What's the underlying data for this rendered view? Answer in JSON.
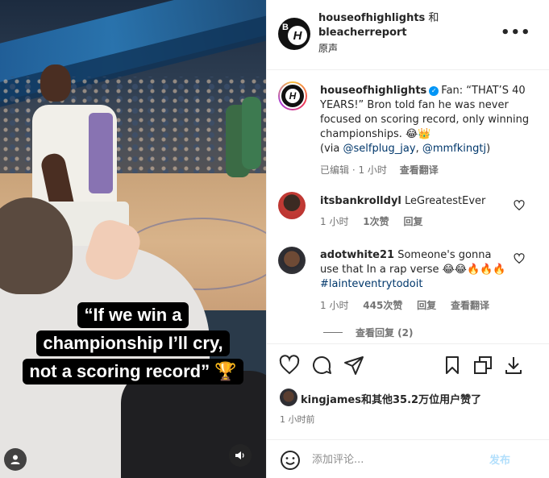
{
  "header": {
    "account1": "houseofhighlights",
    "and": " 和",
    "account2": "bleacherreport",
    "sub": "原声",
    "more_label": "•••"
  },
  "caption": {
    "username": "houseofhighlights",
    "text": "Fan: “THAT’S 40 YEARS!” Bron told fan he was never focused on scoring record, only winning championships. 😂👑",
    "via_prefix": "(via ",
    "tag1": "@selfplug_jay",
    "sep": ", ",
    "tag2": "@mmfkingtj",
    "via_suffix": ")",
    "meta_edited": "已编辑 · 1 小时",
    "meta_translate": "查看翻译"
  },
  "comments": [
    {
      "username": "itsbankrolldyl",
      "text": "LeGreatestEver",
      "time": "1 小时",
      "likes": "1次赞",
      "reply": "回复"
    },
    {
      "username": "adotwhite21",
      "text": "Someone's gonna use that In a rap verse 😂😂🔥🔥🔥",
      "tag": "#lainteventrytodoit",
      "time": "1 小时",
      "likes": "445次赞",
      "reply": "回复",
      "translate": "查看翻译",
      "view_replies": "查看回复 (2)"
    }
  ],
  "video_caption": {
    "line1": "“If we win a",
    "line2": "championship I’ll cry,",
    "line3": "not a scoring record” 🏆"
  },
  "likes": {
    "user": "kingjames",
    "text": "和其他35.2万位用户赞了"
  },
  "time_ago": "1 小时前",
  "add_comment": {
    "placeholder": "添加评论...",
    "post_label": "发布"
  },
  "icons": {
    "like": "heart-icon",
    "comment": "comment-icon",
    "share": "send-icon",
    "save": "bookmark-icon",
    "collections": "collections-icon",
    "download": "download-icon",
    "emoji": "emoji-icon",
    "user": "user-icon",
    "sound": "speaker-icon"
  },
  "colors": {
    "link": "#00376b",
    "verified": "#0095f6",
    "secondary_text": "#737373"
  }
}
